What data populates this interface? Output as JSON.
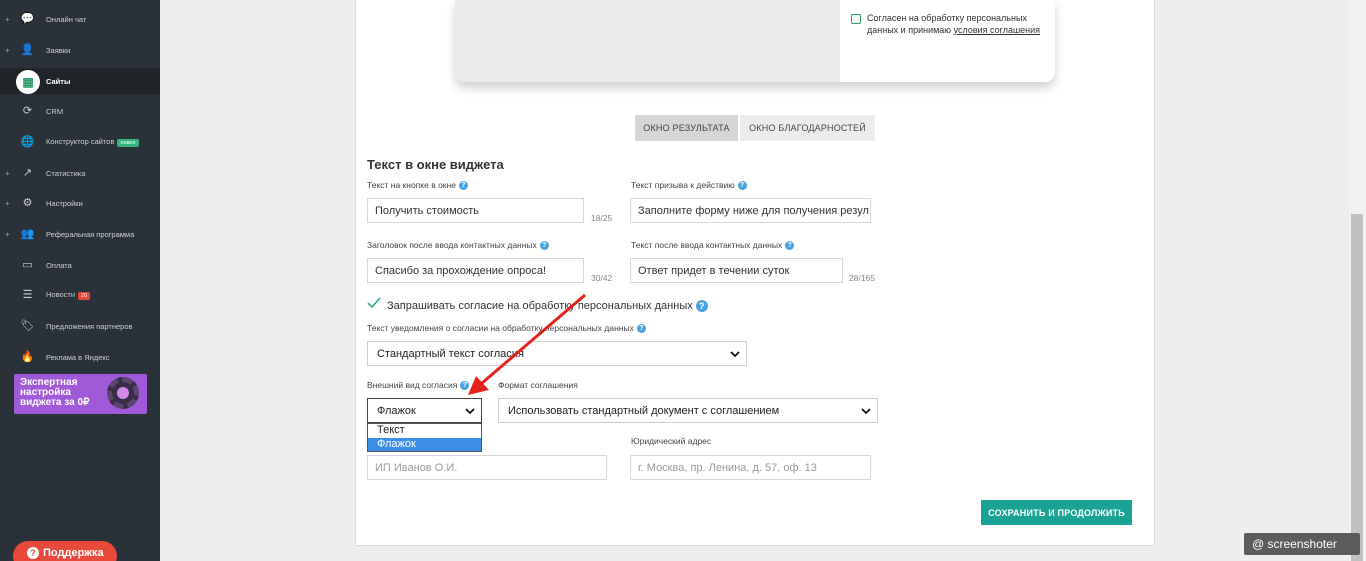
{
  "sidebar": {
    "items": [
      {
        "label": "Онлайн чат",
        "icon": "chat-icon",
        "plus": "+",
        "glyph": "💬"
      },
      {
        "label": "Заявки",
        "icon": "person-icon",
        "plus": "+",
        "glyph": "👤"
      },
      {
        "label": "Сайты",
        "icon": "apps-icon",
        "plus": "",
        "glyph": "▦"
      },
      {
        "label": "CRM",
        "icon": "crm-icon",
        "plus": "",
        "glyph": "⟳"
      },
      {
        "label": "Конструктор сайтов",
        "icon": "globe-icon",
        "plus": "",
        "glyph": "🌐",
        "badge": "новое"
      },
      {
        "label": "Статистика",
        "icon": "trend-icon",
        "plus": "+",
        "glyph": "↗"
      },
      {
        "label": "Настройки",
        "icon": "gear-icon",
        "plus": "+",
        "glyph": "⚙"
      },
      {
        "label": "Реферальная программа",
        "icon": "people-icon",
        "plus": "+",
        "glyph": "👥"
      },
      {
        "label": "Оплата",
        "icon": "card-icon",
        "plus": "",
        "glyph": "▭"
      },
      {
        "label": "Новости",
        "icon": "news-icon",
        "plus": "",
        "glyph": "☰",
        "count": "20"
      },
      {
        "label": "Предложения партнеров",
        "icon": "tag-icon",
        "plus": "",
        "glyph": "🏷"
      },
      {
        "label": "Реклама в Яндекс",
        "icon": "fire-icon",
        "plus": "",
        "glyph": "🔥"
      }
    ],
    "promo": "Экспертная\nнастройка\nвиджета за 0₽",
    "support": "Поддержка",
    "support_glyph": "?"
  },
  "preview": {
    "consent_text": "Согласен на обработку персональных данных и принимаю",
    "consent_link": "условия соглашения"
  },
  "tabs": {
    "result": "ОКНО РЕЗУЛЬТАТА",
    "thanks": "ОКНО БЛАГОДАРНОСТЕЙ"
  },
  "form": {
    "section_title": "Текст в окне виджета",
    "button_text_label": "Текст на кнопке в окне",
    "button_text_value": "Получить стоимость",
    "button_text_counter": "18/25",
    "cta_label": "Текст призыва к действию",
    "cta_value": "Заполните форму ниже для получения резул",
    "after_title_label": "Заголовок после ввода контактных данных",
    "after_title_value": "Спасибо за прохождение опроса!",
    "after_title_counter": "30/42",
    "after_text_label": "Текст после ввода контактных данных",
    "after_text_value": "Ответ придет в течении суток",
    "after_text_counter": "28/165",
    "ask_consent_label": "Запрашивать согласие на обработку персональных данных",
    "notice_label": "Текст уведомления о согласии на обработку персональных данных",
    "notice_value": "Стандартный текст согласия",
    "appearance_label": "Внешний вид согласия",
    "appearance_value": "Флажок",
    "appearance_options": [
      "Текст",
      "Флажок"
    ],
    "format_label": "Формат соглашения",
    "format_value": "Использовать стандартный документ с соглашением",
    "legal_address_label": "Юридический адрес",
    "company_placeholder": "ИП Иванов О.И.",
    "address_placeholder": "г. Москва, пр. Ленина, д. 57, оф. 13",
    "help_glyph": "?",
    "save_button": "СОХРАНИТЬ И ПРОДОЛЖИТЬ"
  },
  "watermark": "@ screenshoter",
  "colors": {
    "sidebar_bg": "#2b3138",
    "accent": "#1aa394",
    "arrow": "#e3221b",
    "promo": "#a05ad8",
    "support": "#e8493b"
  }
}
